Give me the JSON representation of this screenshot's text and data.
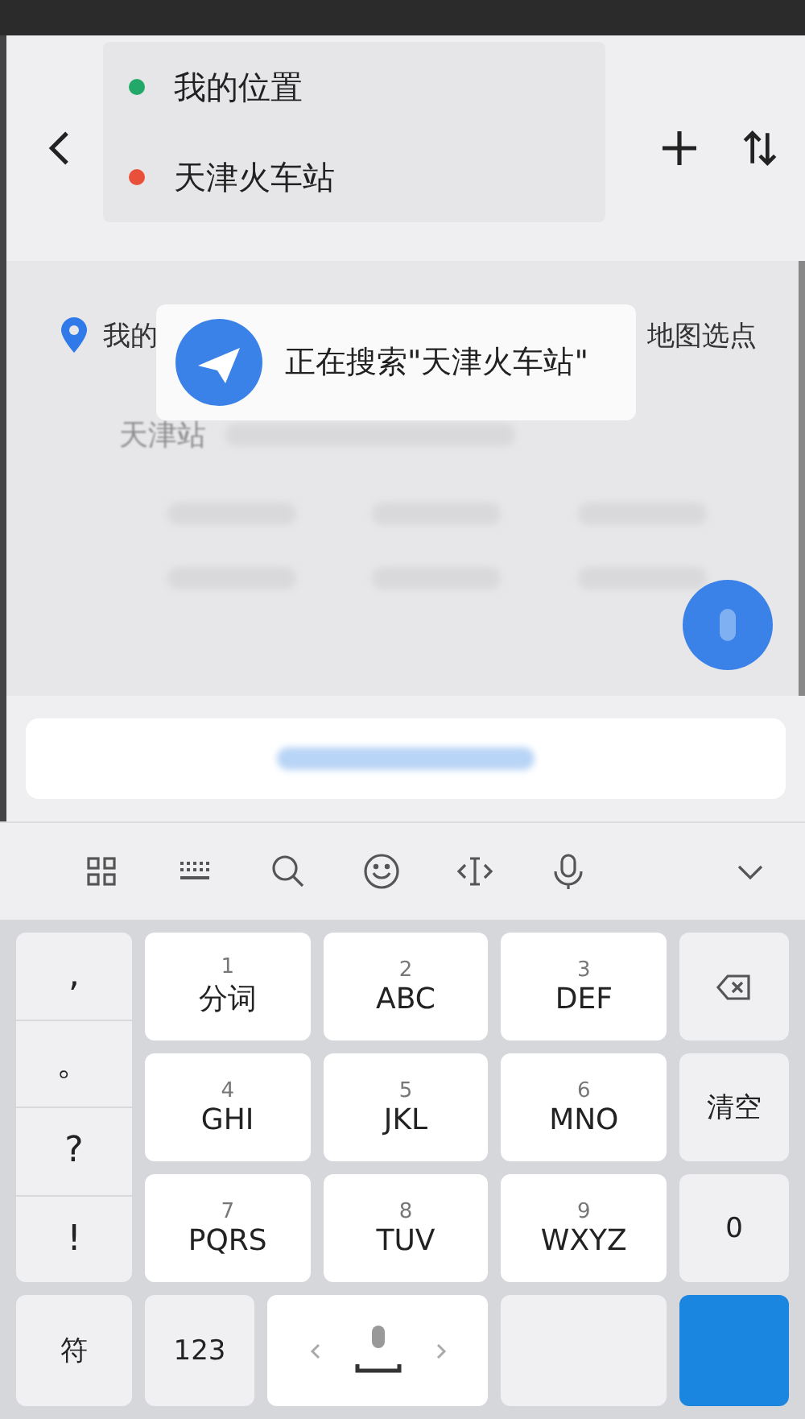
{
  "route": {
    "origin": "我的位置",
    "destination": "天津火车站"
  },
  "quick_options": [
    {
      "label": "我的",
      "kind": "location"
    },
    {
      "label": "地图选点",
      "kind": "map"
    }
  ],
  "result": {
    "name": "天津站"
  },
  "toast": {
    "text": "正在搜索\"天津火车站\""
  },
  "keyboard": {
    "punctuation": [
      ",",
      "。",
      "?",
      "!"
    ],
    "keys": [
      {
        "digit": "1",
        "letters": "分词"
      },
      {
        "digit": "2",
        "letters": "ABC"
      },
      {
        "digit": "3",
        "letters": "DEF"
      },
      {
        "digit": "4",
        "letters": "GHI"
      },
      {
        "digit": "5",
        "letters": "JKL"
      },
      {
        "digit": "6",
        "letters": "MNO"
      },
      {
        "digit": "7",
        "letters": "PQRS"
      },
      {
        "digit": "8",
        "letters": "TUV"
      },
      {
        "digit": "9",
        "letters": "WXYZ"
      }
    ],
    "side_keys": [
      {
        "kind": "delete"
      },
      {
        "kind": "text",
        "label": "清空"
      },
      {
        "kind": "text",
        "label": "0"
      }
    ],
    "bottom_keys": [
      {
        "kind": "text",
        "label": "符"
      },
      {
        "kind": "text",
        "label": "123"
      },
      {
        "kind": "space"
      },
      {
        "kind": "blank"
      },
      {
        "kind": "enter"
      }
    ]
  }
}
